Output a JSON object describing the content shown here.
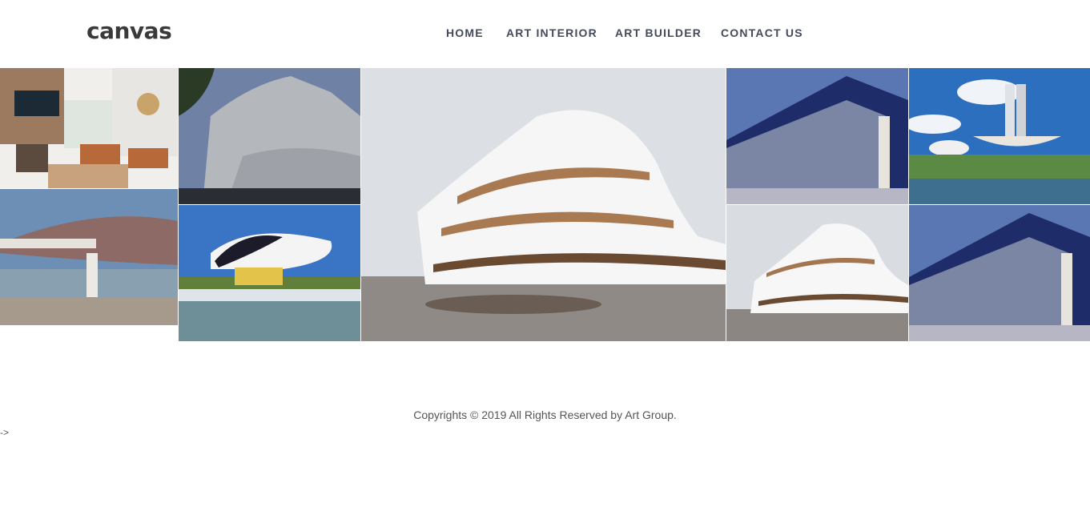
{
  "header": {
    "logo": "canvas",
    "nav": [
      {
        "label": "HOME"
      },
      {
        "label": "ART INTERIOR"
      },
      {
        "label": "ART BUILDER"
      },
      {
        "label": "CONTACT US"
      }
    ]
  },
  "gallery": [
    {
      "subject": "living-room-interior"
    },
    {
      "subject": "curved-steel-concert-hall"
    },
    {
      "subject": "flying-saucer-museum"
    },
    {
      "subject": "eye-shaped-museum"
    },
    {
      "subject": "curved-white-building-large"
    },
    {
      "subject": "glass-facade-building"
    },
    {
      "subject": "twin-towers-congress-dome"
    },
    {
      "subject": "curved-white-building-small"
    },
    {
      "subject": "glass-facade-building-2"
    }
  ],
  "footer": {
    "copyright": "Copyrights © 2019 All Rights Reserved by Art Group.",
    "stray_text": "->"
  }
}
